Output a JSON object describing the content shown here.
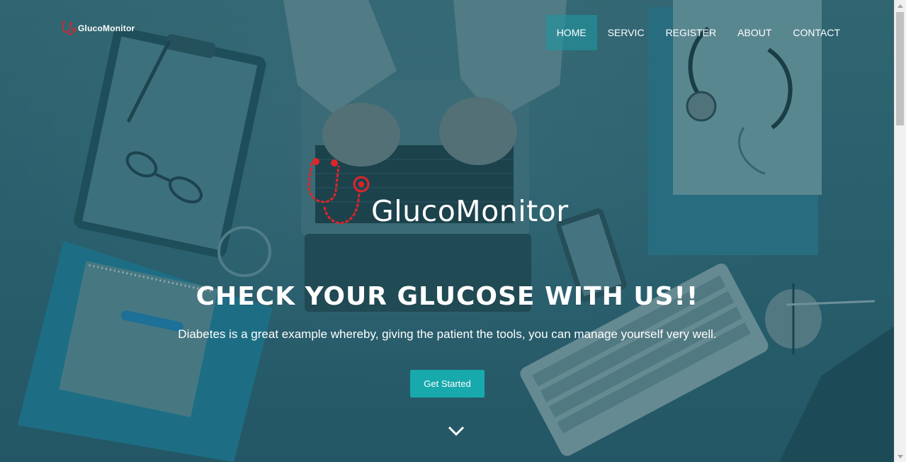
{
  "header": {
    "logo_text": "GlucoMonitor",
    "nav": [
      {
        "label": "HOME",
        "active": true
      },
      {
        "label": "SERVIC",
        "active": false
      },
      {
        "label": "REGISTER",
        "active": false
      },
      {
        "label": "ABOUT",
        "active": false
      },
      {
        "label": "CONTACT",
        "active": false
      }
    ]
  },
  "hero": {
    "brand_text": "GlucoMonitor",
    "headline": "CHECK YOUR GLUCOSE WITH US!!",
    "subtext": "Diabetes is a great example whereby, giving the patient the tools, you can manage yourself very well.",
    "cta_label": "Get Started",
    "scroll_icon": "chevron-down-icon"
  },
  "colors": {
    "accent": "#17a9ac",
    "overlay": "#2b5f6c",
    "logo_red": "#e0242a"
  }
}
